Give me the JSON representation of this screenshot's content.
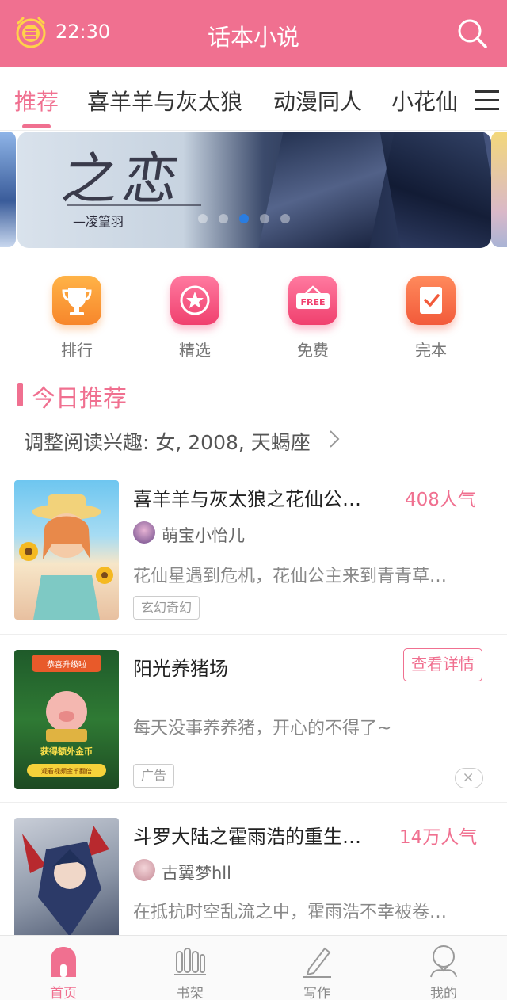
{
  "header": {
    "time": "22:30",
    "title": "话本小说"
  },
  "tabs": [
    {
      "label": "推荐",
      "active": true
    },
    {
      "label": "喜羊羊与灰太狼",
      "active": false
    },
    {
      "label": "动漫同人",
      "active": false
    },
    {
      "label": "小花仙",
      "active": false
    }
  ],
  "banner": {
    "calligraphy": "之恋",
    "author": "—凌篁羽",
    "active_dot": 2,
    "dot_count": 5
  },
  "entries": [
    {
      "label": "排行",
      "icon": "trophy-icon",
      "color": "#f9943a"
    },
    {
      "label": "精选",
      "icon": "star-icon",
      "color": "#f4577e"
    },
    {
      "label": "免费",
      "icon": "free-sign-icon",
      "color": "#f4577e",
      "badge": "FREE"
    },
    {
      "label": "完本",
      "icon": "checkbook-icon",
      "color": "#f47048"
    }
  ],
  "section": {
    "title": "今日推荐",
    "preference": "调整阅读兴趣: 女, 2008, 天蝎座"
  },
  "books": [
    {
      "title": "喜羊羊与灰太狼之花仙公…",
      "hot": "408人气",
      "author": "萌宝小怡儿",
      "desc": "花仙星遇到危机，花仙公主来到青青草…",
      "tag": "玄幻奇幻"
    },
    {
      "title": "阳光养猪场",
      "button": "查看详情",
      "desc": "每天没事养养猪，开心的不得了~",
      "tag": "广告",
      "ad_banner_top": "恭喜升级啦",
      "ad_banner_mid": "获得额外金币",
      "ad_banner_btn": "观看视频金币翻倍"
    },
    {
      "title": "斗罗大陆之霍雨浩的重生…",
      "hot": "14万人气",
      "author": "古翼梦hll",
      "desc": "在抵抗时空乱流之中，霍雨浩不幸被卷…"
    }
  ],
  "tabbar": [
    {
      "label": "首页",
      "active": true
    },
    {
      "label": "书架",
      "active": false
    },
    {
      "label": "写作",
      "active": false
    },
    {
      "label": "我的",
      "active": false
    }
  ],
  "colors": {
    "brand": "#f07090",
    "banner_dot_active": "#2a7de1"
  }
}
